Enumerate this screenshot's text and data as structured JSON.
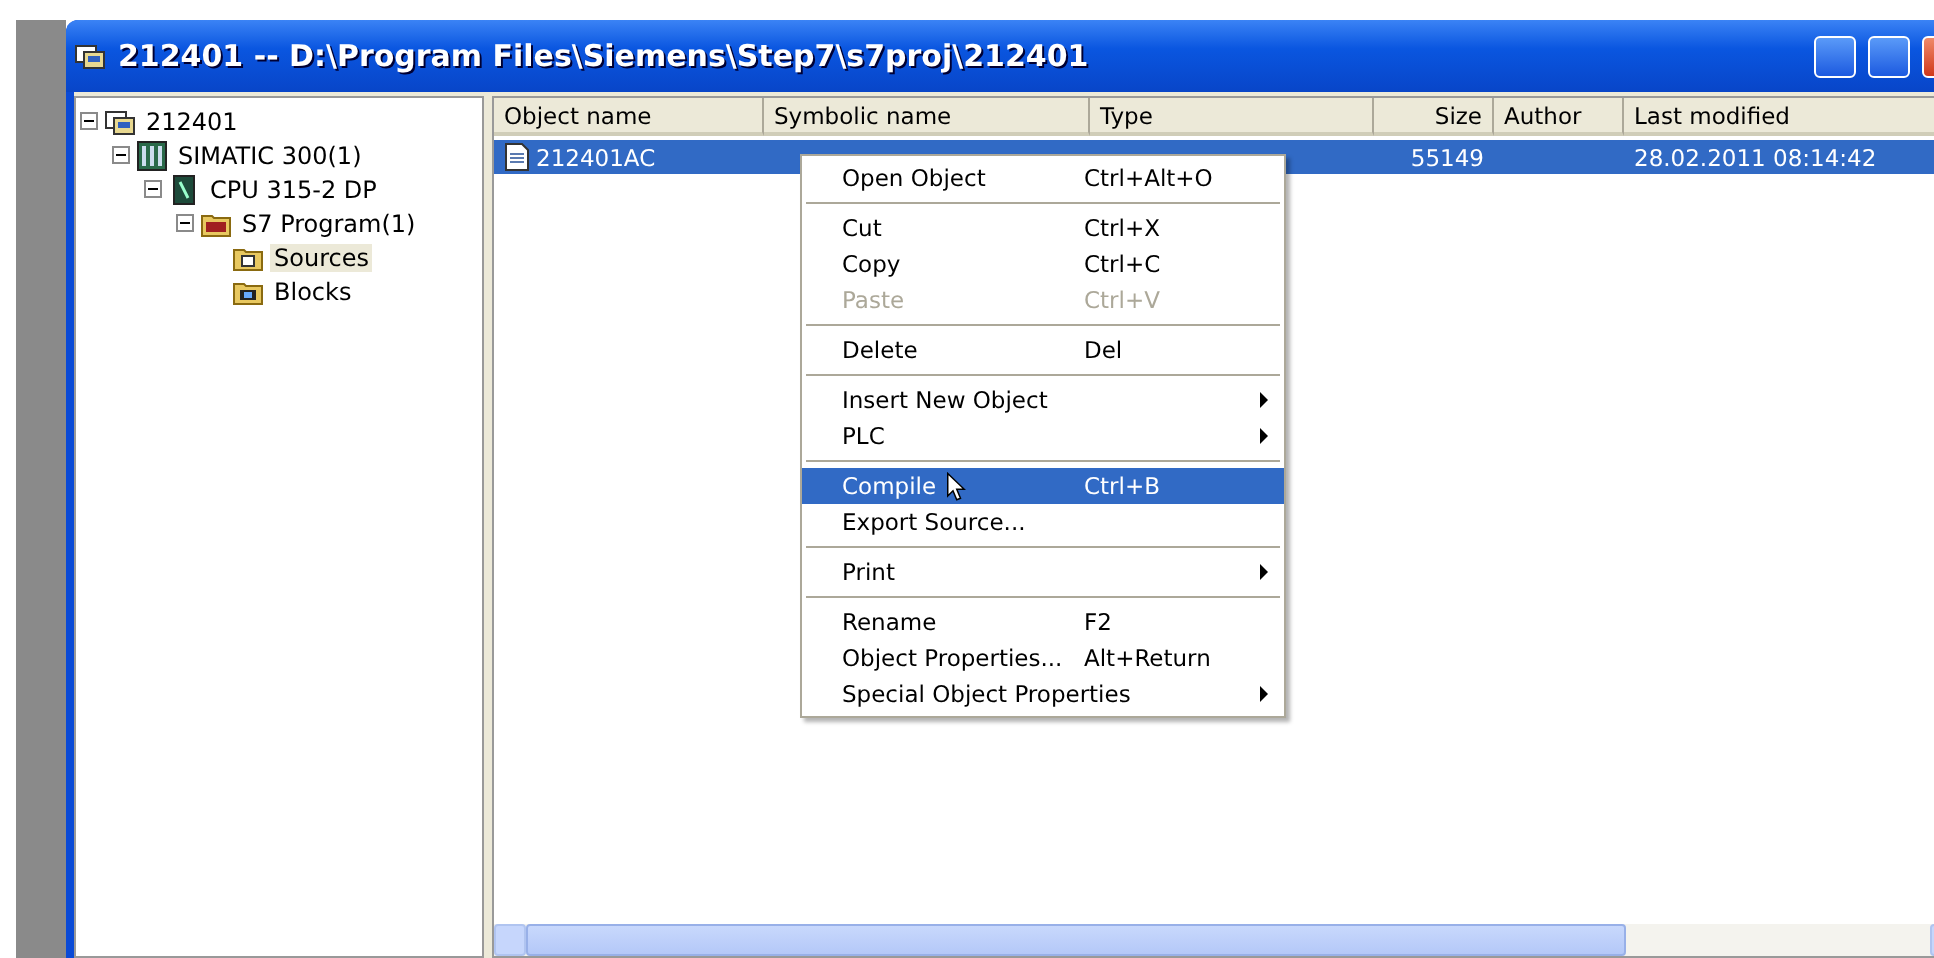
{
  "window": {
    "title": "212401 -- D:\\Program Files\\Siemens\\Step7\\s7proj\\212401"
  },
  "tree": [
    {
      "label": "212401",
      "kind": "project",
      "expanded": true,
      "selected": false,
      "children": [
        {
          "label": "SIMATIC 300(1)",
          "kind": "station",
          "expanded": true,
          "selected": false,
          "children": [
            {
              "label": "CPU 315-2 DP",
              "kind": "cpu",
              "expanded": true,
              "selected": false,
              "children": [
                {
                  "label": "S7 Program(1)",
                  "kind": "program",
                  "expanded": true,
                  "selected": false,
                  "children": [
                    {
                      "label": "Sources",
                      "kind": "sources",
                      "selected": true
                    },
                    {
                      "label": "Blocks",
                      "kind": "blocks",
                      "selected": false
                    }
                  ]
                }
              ]
            }
          ]
        }
      ]
    }
  ],
  "table": {
    "columns": [
      {
        "label": "Object name",
        "kind": "text"
      },
      {
        "label": "Symbolic name",
        "kind": "text"
      },
      {
        "label": "Type",
        "kind": "text"
      },
      {
        "label": "Size",
        "kind": "number"
      },
      {
        "label": "Author",
        "kind": "text"
      },
      {
        "label": "Last modified",
        "kind": "text"
      }
    ],
    "rows": [
      {
        "selected": true,
        "object_name": "212401AC",
        "size": "55149",
        "last_modified": "28.02.2011   08:14:42"
      }
    ]
  },
  "context_menu": {
    "groups": [
      [
        {
          "label": "Open Object",
          "shortcut": "Ctrl+Alt+O",
          "submenu": false,
          "disabled": false,
          "selected": false
        }
      ],
      [
        {
          "label": "Cut",
          "shortcut": "Ctrl+X",
          "submenu": false,
          "disabled": false,
          "selected": false
        },
        {
          "label": "Copy",
          "shortcut": "Ctrl+C",
          "submenu": false,
          "disabled": false,
          "selected": false
        },
        {
          "label": "Paste",
          "shortcut": "Ctrl+V",
          "submenu": false,
          "disabled": true,
          "selected": false
        }
      ],
      [
        {
          "label": "Delete",
          "shortcut": "Del",
          "submenu": false,
          "disabled": false,
          "selected": false
        }
      ],
      [
        {
          "label": "Insert New Object",
          "submenu": true,
          "disabled": false,
          "selected": false
        },
        {
          "label": "PLC",
          "submenu": true,
          "disabled": false,
          "selected": false
        }
      ],
      [
        {
          "label": "Compile",
          "shortcut": "Ctrl+B",
          "submenu": false,
          "disabled": false,
          "selected": true
        },
        {
          "label": "Export Source...",
          "submenu": false,
          "disabled": false,
          "selected": false
        }
      ],
      [
        {
          "label": "Print",
          "submenu": true,
          "disabled": false,
          "selected": false
        }
      ],
      [
        {
          "label": "Rename",
          "shortcut": "F2",
          "submenu": false,
          "disabled": false,
          "selected": false
        },
        {
          "label": "Object Properties...",
          "shortcut": "Alt+Return",
          "submenu": false,
          "disabled": false,
          "selected": false
        },
        {
          "label": "Special Object Properties",
          "submenu": true,
          "disabled": false,
          "selected": false
        }
      ]
    ]
  }
}
